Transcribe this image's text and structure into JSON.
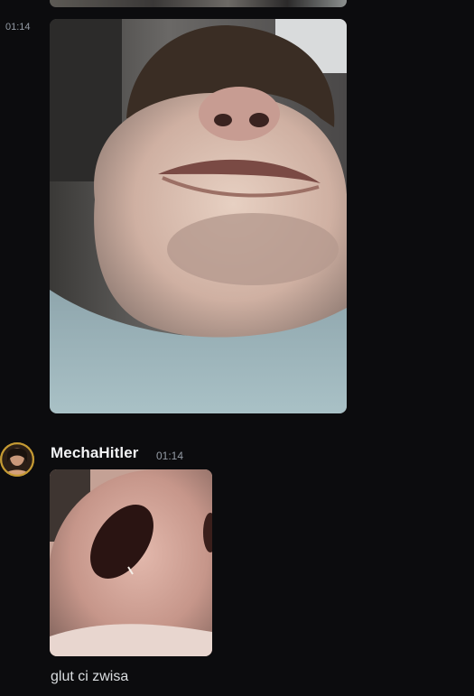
{
  "messages": {
    "first": {
      "timestamp": "01:14"
    },
    "second": {
      "username": "MechaHitler",
      "timestamp": "01:14",
      "text": "glut ci zwisa"
    }
  },
  "colors": {
    "background": "#0c0c0e",
    "username": "#f2f3f5",
    "timestamp": "#949ba4",
    "text": "#dbdee1"
  }
}
